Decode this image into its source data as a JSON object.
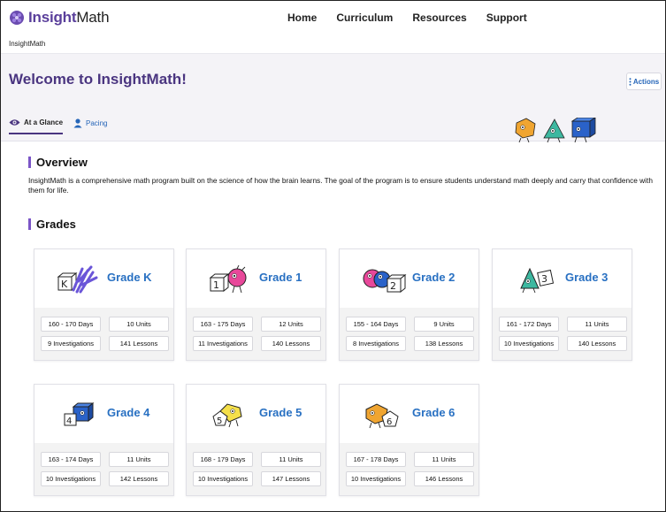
{
  "app": {
    "brand_prefix": "Insight",
    "brand_suffix": "Math"
  },
  "nav": {
    "links": [
      "Home",
      "Curriculum",
      "Resources",
      "Support"
    ]
  },
  "breadcrumb": "InsightMath",
  "header": {
    "title": "Welcome to InsightMath!",
    "actions_label": "Actions",
    "tabs": [
      {
        "label": "At a Glance",
        "icon": "eye-icon",
        "active": true
      },
      {
        "label": "Pacing",
        "icon": "person-icon",
        "active": false
      }
    ]
  },
  "overview": {
    "heading": "Overview",
    "text": "InsightMath is a comprehensive math program built on the science of how the brain learns. The goal of the program is to ensure students understand math deeply and carry that confidence with them for life."
  },
  "grades": {
    "heading": "Grades",
    "cards": [
      {
        "name": "Grade K",
        "days": "160 - 170 Days",
        "units": "10 Units",
        "investigations": "9 Investigations",
        "lessons": "141 Lessons",
        "badge": "K"
      },
      {
        "name": "Grade 1",
        "days": "163 - 175 Days",
        "units": "12 Units",
        "investigations": "11 Investigations",
        "lessons": "140 Lessons",
        "badge": "1"
      },
      {
        "name": "Grade 2",
        "days": "155 - 164 Days",
        "units": "9 Units",
        "investigations": "8 Investigations",
        "lessons": "138 Lessons",
        "badge": "2"
      },
      {
        "name": "Grade 3",
        "days": "161 - 172 Days",
        "units": "11 Units",
        "investigations": "10 Investigations",
        "lessons": "140 Lessons",
        "badge": "3"
      },
      {
        "name": "Grade 4",
        "days": "163 - 174 Days",
        "units": "11 Units",
        "investigations": "10 Investigations",
        "lessons": "142 Lessons",
        "badge": "4"
      },
      {
        "name": "Grade 5",
        "days": "168 - 179 Days",
        "units": "11 Units",
        "investigations": "10 Investigations",
        "lessons": "147 Lessons",
        "badge": "5"
      },
      {
        "name": "Grade 6",
        "days": "167 - 178 Days",
        "units": "11 Units",
        "investigations": "10 Investigations",
        "lessons": "146 Lessons",
        "badge": "6"
      }
    ]
  },
  "colors": {
    "brand_purple": "#4a3580",
    "accent": "#7b55c7",
    "link_blue": "#2870c2"
  }
}
